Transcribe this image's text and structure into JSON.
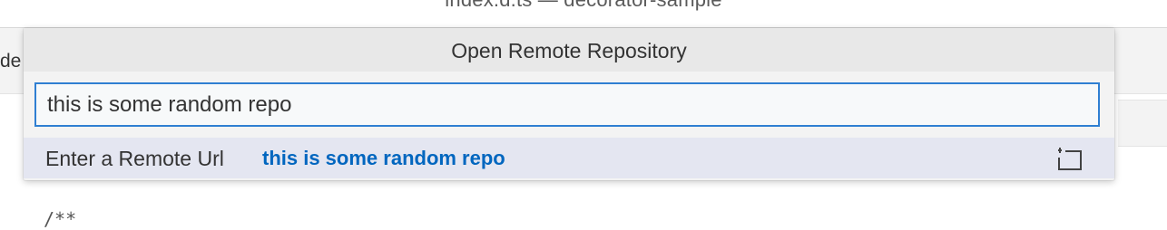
{
  "window": {
    "title": "index.d.ts — decorator-sample"
  },
  "background": {
    "tab_fragment": "de",
    "code_fragment": "/**"
  },
  "quick_pick": {
    "title": "Open Remote Repository",
    "input": {
      "value": "this is some random repo"
    },
    "items": [
      {
        "label": "Enter a Remote Url",
        "description": "this is some random repo",
        "action_icon": "new-folder-icon"
      }
    ]
  },
  "colors": {
    "focus_border": "#2f7fd2",
    "highlight_text": "#0066bf",
    "selected_row": "#e4e6f1",
    "widget_background": "#f3f3f3"
  }
}
